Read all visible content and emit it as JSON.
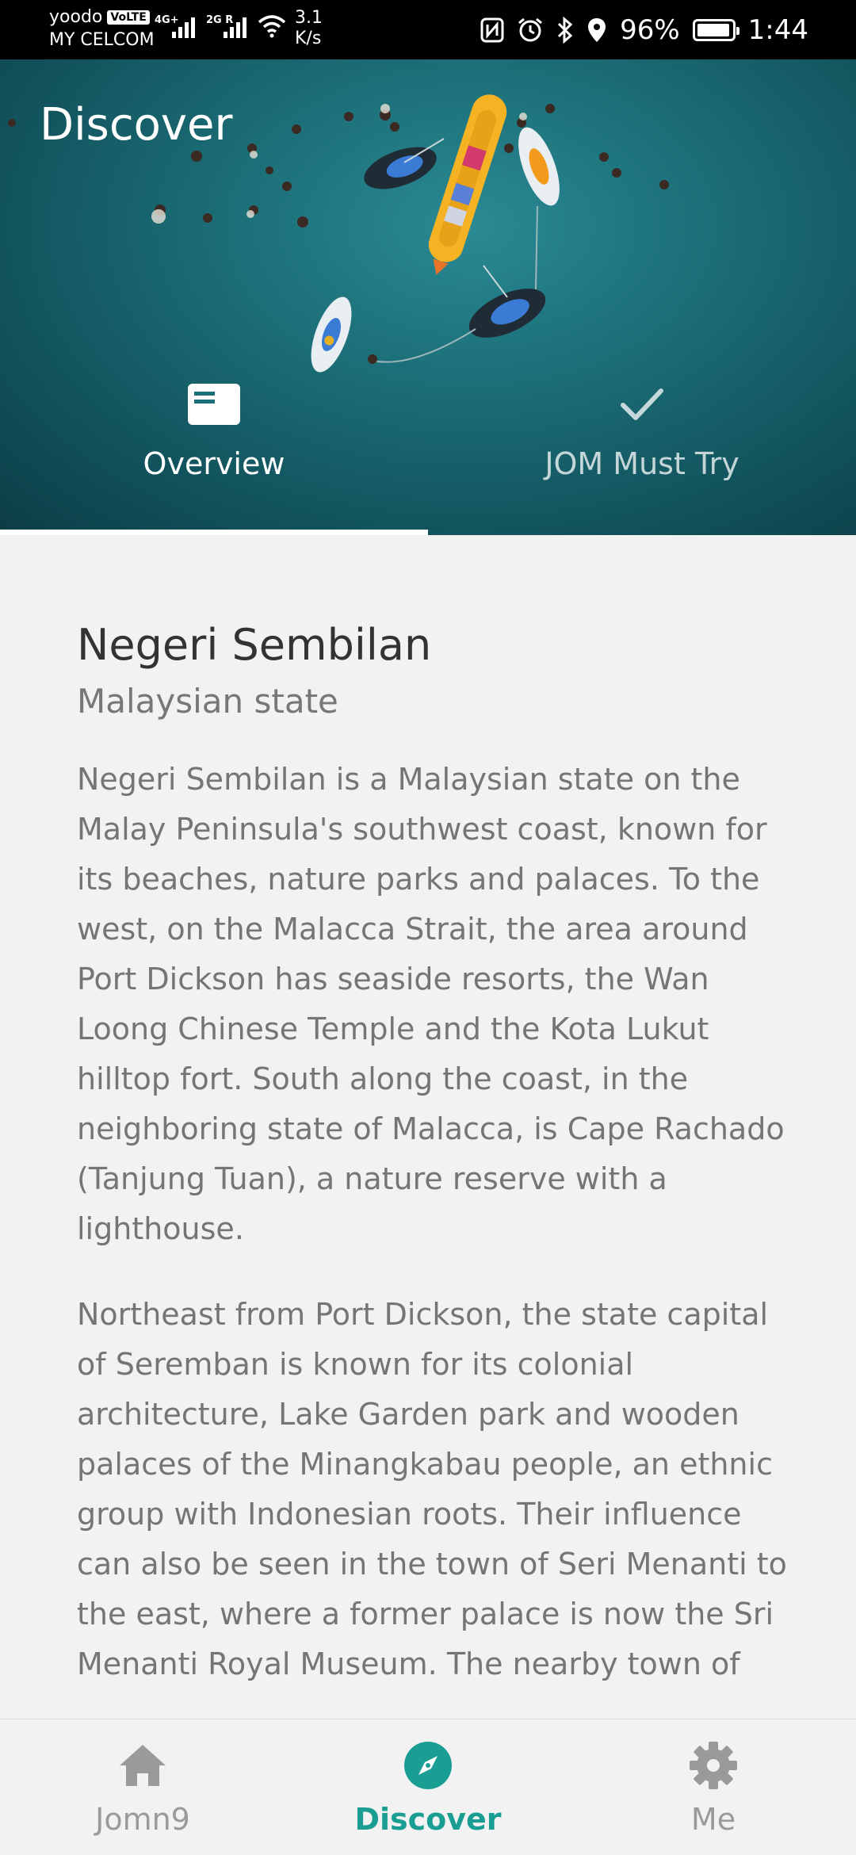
{
  "status_bar": {
    "carrier_line1": "yoodo",
    "volte_badge": "VoLTE",
    "carrier_line2": "MY CELCOM",
    "signal1_tag": "4G+",
    "signal2_tag": "2G R",
    "net_speed_value": "3.1",
    "net_speed_unit": "K/s",
    "battery_percent": "96%",
    "time": "1:44",
    "icons": [
      "nfc-icon",
      "alarm-icon",
      "bluetooth-icon",
      "location-icon",
      "battery-icon"
    ]
  },
  "header": {
    "title": "Discover"
  },
  "tabs": [
    {
      "label": "Overview",
      "icon": "card-icon",
      "active": true
    },
    {
      "label": "JOM Must Try",
      "icon": "check-icon",
      "active": false
    }
  ],
  "place": {
    "name": "Negeri Sembilan",
    "type": "Malaysian state",
    "paragraphs": [
      "Negeri Sembilan is a Malaysian state on the Malay Peninsula's southwest coast, known for its beaches, nature parks and palaces. To the west, on the Malacca Strait, the area around Port Dickson has seaside resorts, the Wan Loong Chinese Temple and the Kota Lukut hilltop fort. South along the coast, in the neighboring state of Malacca, is Cape Rachado (Tanjung Tuan), a nature reserve with a lighthouse.",
      "Northeast from Port Dickson, the state capital of Seremban is known for its colonial architecture, Lake Garden park and wooden palaces of the Minangkabau people, an ethnic group with Indonesian roots. Their influence can also be seen in the town of Seri Menanti to the east, where a former palace is now the Sri Menanti Royal Museum. The nearby town of"
    ]
  },
  "bottom_nav": [
    {
      "label": "Jomn9",
      "icon": "home-icon",
      "active": false
    },
    {
      "label": "Discover",
      "icon": "compass-icon",
      "active": true
    },
    {
      "label": "Me",
      "icon": "gear-icon",
      "active": false
    }
  ],
  "colors": {
    "accent": "#1a9e93",
    "inactive": "#9a9a9a",
    "hero_sea": "#1c6f78"
  }
}
